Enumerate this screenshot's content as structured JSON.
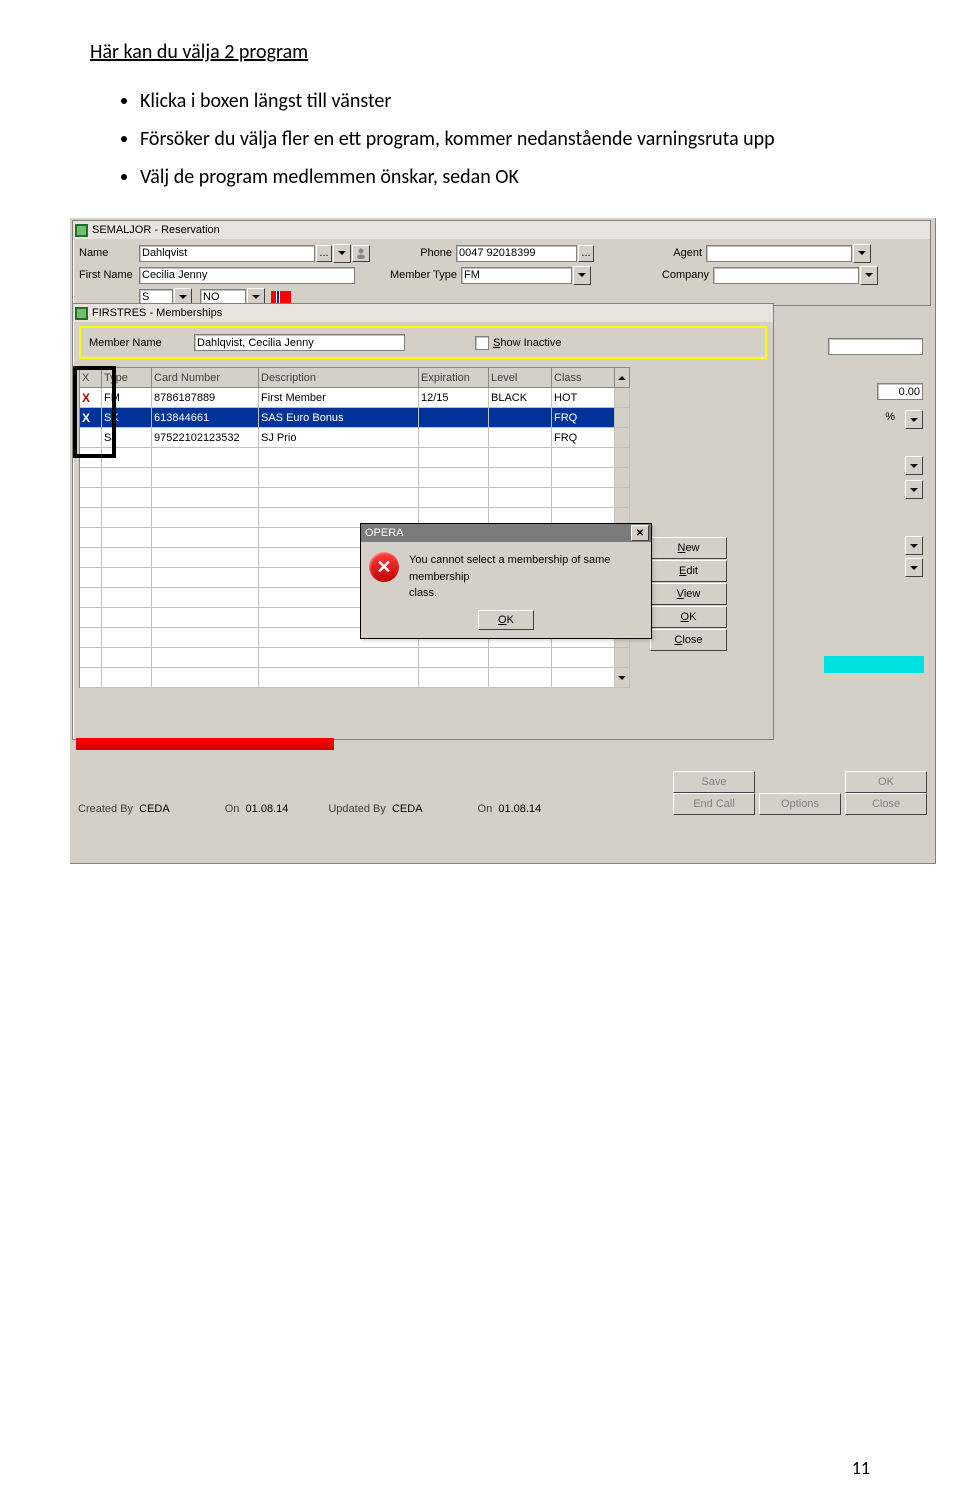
{
  "doc": {
    "heading": "Här kan du välja 2 program",
    "bullets": [
      "Klicka i boxen längst till vänster",
      "Försöker du välja fler en ett program, kommer nedanstående varningsruta upp",
      "Välj de program medlemmen önskar, sedan OK"
    ],
    "page_number": "11"
  },
  "win1": {
    "title": "SEMALJOR - Reservation",
    "labels": {
      "name": "Name",
      "first_name": "First Name",
      "phone": "Phone",
      "member_type": "Member Type",
      "agent": "Agent",
      "company": "Company"
    },
    "values": {
      "name": "Dahlqvist",
      "first_name": "Cecilia Jenny",
      "phone": "0047 92018399",
      "member_type": "FM",
      "country": "NO"
    }
  },
  "win2": {
    "title": "FIRSTRES - Memberships",
    "member_name_label": "Member Name",
    "member_name": "Dahlqvist, Cecilia Jenny",
    "show_inactive": "Show Inactive",
    "headers": {
      "x": "X",
      "type": "Type",
      "card": "Card Number",
      "desc": "Description",
      "exp": "Expiration",
      "level": "Level",
      "class": "Class"
    },
    "rows": [
      {
        "x": "X",
        "type": "FM",
        "card": "8786187889",
        "desc": "First Member",
        "exp": "12/15",
        "level": "BLACK",
        "class": "HOT",
        "selected": false
      },
      {
        "x": "X",
        "type": "SK",
        "card": "613844661",
        "desc": "SAS Euro Bonus",
        "exp": "",
        "level": "",
        "class": "FRQ",
        "selected": true
      },
      {
        "x": "",
        "type": "SJ",
        "card": "97522102123532",
        "desc": "SJ Prio",
        "exp": "",
        "level": "",
        "class": "FRQ",
        "selected": false
      }
    ],
    "side_buttons": [
      "New",
      "Edit",
      "View",
      "OK",
      "Close"
    ],
    "misc_value": "0.00",
    "percent": "%"
  },
  "dialog": {
    "title": "OPERA",
    "message_l1": "You cannot select a membership of same membership",
    "message_l2": "class.",
    "ok": "OK"
  },
  "footer": {
    "created_by_label": "Created By",
    "created_by": "CEDA",
    "on_label": "On",
    "created_on": "01.08.14",
    "updated_by_label": "Updated By",
    "updated_by": "CEDA",
    "updated_on": "01.08.14",
    "buttons": [
      "Save",
      "OK",
      "End Call",
      "Options",
      "Close"
    ]
  }
}
